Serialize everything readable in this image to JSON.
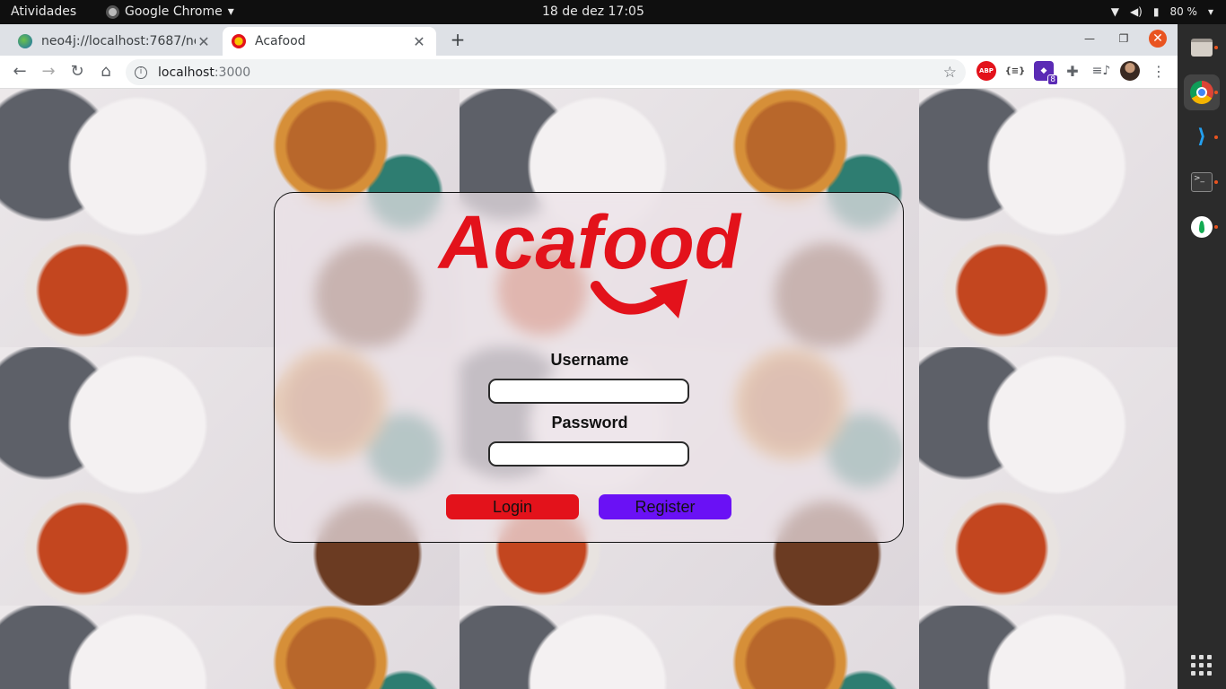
{
  "topbar": {
    "activities": "Atividades",
    "app_name": "Google Chrome",
    "clock": "18 de dez  17:05",
    "battery": "80 %"
  },
  "browser": {
    "tabs": [
      {
        "title": "neo4j://localhost:7687/ne",
        "icon": "neo4j-browser-icon"
      },
      {
        "title": "Acafood",
        "icon": "acafood-favicon"
      }
    ],
    "address": {
      "host": "localhost",
      "port": ":3000"
    }
  },
  "page": {
    "logo_text": "Acafood",
    "username_label": "Username",
    "password_label": "Password",
    "username_value": "",
    "password_value": "",
    "login_label": "Login",
    "register_label": "Register"
  },
  "colors": {
    "brand_red": "#e3121b",
    "register_purple": "#6a11f5",
    "ubuntu_orange": "#e95420"
  }
}
